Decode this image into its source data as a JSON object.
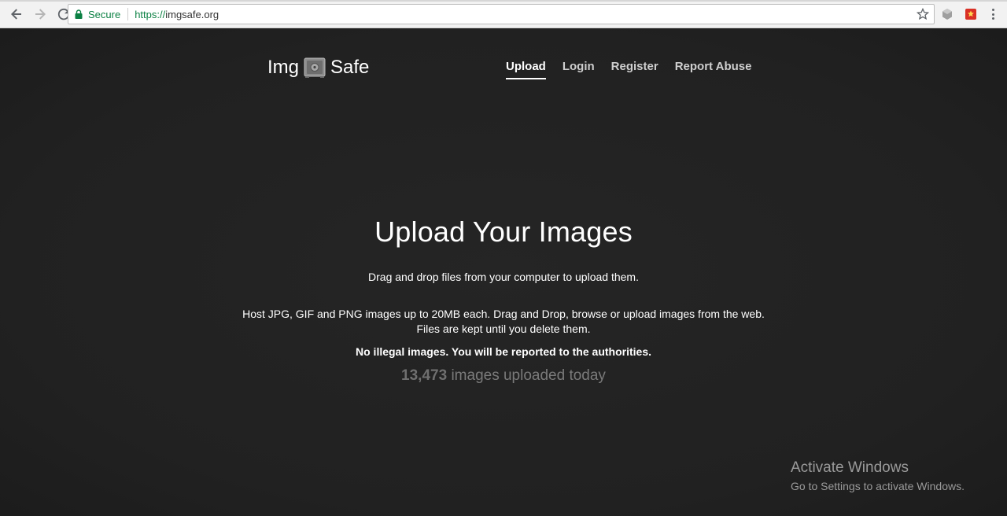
{
  "browser": {
    "secure_label": "Secure",
    "url_scheme": "https://",
    "url_host": "imgsafe.org"
  },
  "site": {
    "logo_left": "Img",
    "logo_right": "Safe",
    "nav": [
      {
        "label": "Upload",
        "active": true
      },
      {
        "label": "Login",
        "active": false
      },
      {
        "label": "Register",
        "active": false
      },
      {
        "label": "Report Abuse",
        "active": false
      }
    ]
  },
  "hero": {
    "title": "Upload Your Images",
    "drag_text": "Drag and drop files from your computer to upload them.",
    "host_line1": "Host JPG, GIF and PNG images up to 20MB each. Drag and Drop, browse or upload images from the web.",
    "host_line2": "Files are kept until you delete them.",
    "warning": "No illegal images. You will be reported to the authorities.",
    "count": "13,473",
    "count_suffix": "images uploaded today"
  },
  "watermark": {
    "line1": "Activate Windows",
    "line2": "Go to Settings to activate Windows."
  },
  "colors": {
    "secure_green": "#0b8043",
    "page_bg": "#232323"
  }
}
